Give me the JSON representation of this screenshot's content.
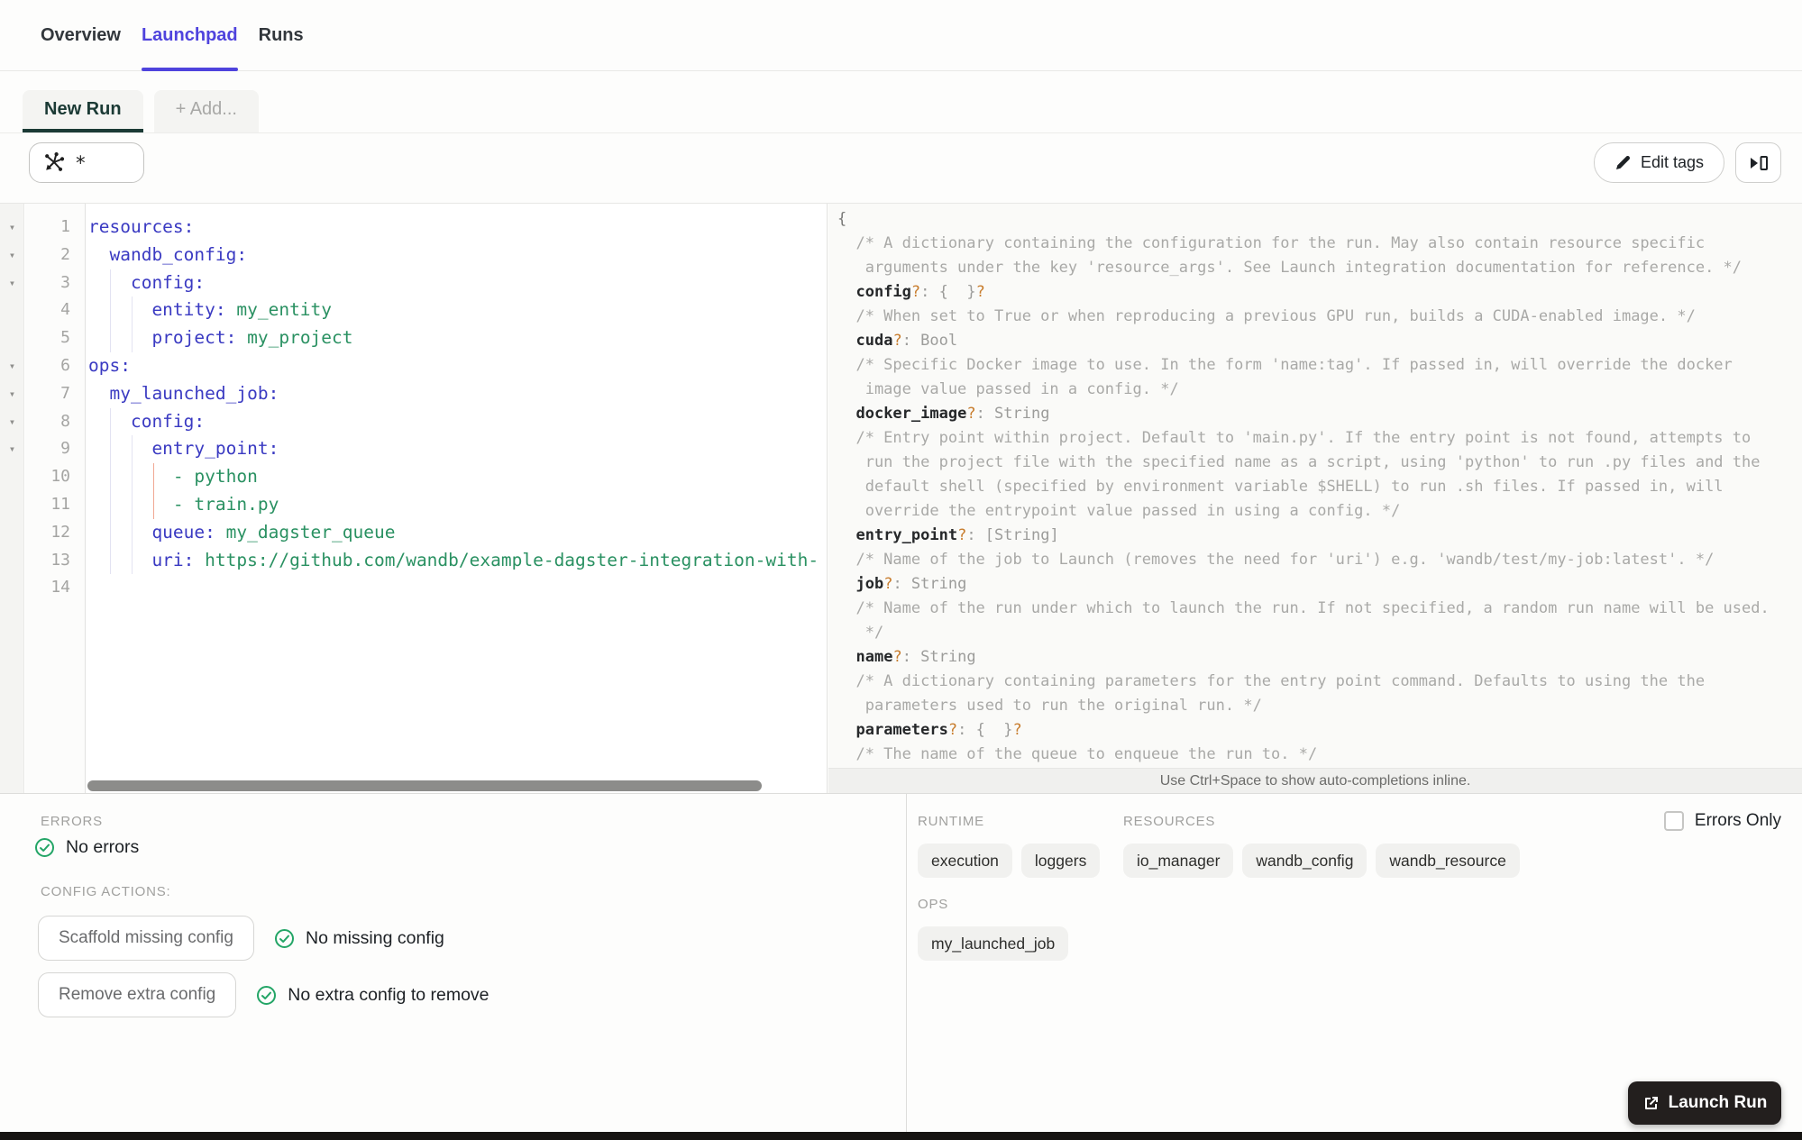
{
  "tabs": {
    "items": [
      {
        "label": "Overview",
        "active": false
      },
      {
        "label": "Launchpad",
        "active": true
      },
      {
        "label": "Runs",
        "active": false
      }
    ]
  },
  "subtabs": {
    "items": [
      {
        "label": "New Run",
        "active": true
      },
      {
        "label": "+ Add...",
        "active": false
      }
    ]
  },
  "toolbar": {
    "op_selector_value": "*",
    "op_selector_icon": "op-splat-icon",
    "edit_tags_label": "Edit tags",
    "edit_tags_icon": "pencil-icon",
    "expand_panel_icon": "play-into-pane-icon"
  },
  "editor": {
    "lines": [
      {
        "n": 1,
        "fold": true,
        "segs": [
          {
            "t": "resources:",
            "c": "key"
          }
        ]
      },
      {
        "n": 2,
        "fold": true,
        "segs": [
          {
            "t": "  wandb_config:",
            "c": "key"
          }
        ]
      },
      {
        "n": 3,
        "fold": true,
        "segs": [
          {
            "t": "    config:",
            "c": "key"
          }
        ]
      },
      {
        "n": 4,
        "fold": false,
        "segs": [
          {
            "t": "      entity:",
            "c": "key"
          },
          {
            "t": " my_entity",
            "c": "val"
          }
        ]
      },
      {
        "n": 5,
        "fold": false,
        "segs": [
          {
            "t": "      project:",
            "c": "key"
          },
          {
            "t": " my_project",
            "c": "val"
          }
        ]
      },
      {
        "n": 6,
        "fold": true,
        "segs": [
          {
            "t": "ops:",
            "c": "key"
          }
        ]
      },
      {
        "n": 7,
        "fold": true,
        "segs": [
          {
            "t": "  my_launched_job:",
            "c": "key"
          }
        ]
      },
      {
        "n": 8,
        "fold": true,
        "segs": [
          {
            "t": "    config:",
            "c": "key"
          }
        ]
      },
      {
        "n": 9,
        "fold": true,
        "segs": [
          {
            "t": "      entry_point:",
            "c": "key"
          }
        ]
      },
      {
        "n": 10,
        "fold": false,
        "segs": [
          {
            "t": "        - python",
            "c": "val"
          }
        ]
      },
      {
        "n": 11,
        "fold": false,
        "segs": [
          {
            "t": "        - train.py",
            "c": "val"
          }
        ]
      },
      {
        "n": 12,
        "fold": false,
        "segs": [
          {
            "t": "      queue:",
            "c": "key"
          },
          {
            "t": " my_dagster_queue",
            "c": "val"
          }
        ]
      },
      {
        "n": 13,
        "fold": false,
        "segs": [
          {
            "t": "      uri:",
            "c": "key"
          },
          {
            "t": " https://github.com/wandb/example-dagster-integration-with-",
            "c": "val"
          }
        ]
      },
      {
        "n": 14,
        "fold": false,
        "segs": []
      }
    ]
  },
  "doc_panel": {
    "hint": "Use Ctrl+Space to show auto-completions inline.",
    "lines": [
      {
        "segs": [
          {
            "t": "{",
            "c": "brace"
          }
        ]
      },
      {
        "segs": [
          {
            "t": "  /* A dictionary containing the configuration for the run. May also contain resource specific",
            "c": "comment"
          }
        ]
      },
      {
        "segs": [
          {
            "t": "   arguments under the key 'resource_args'. See Launch integration documentation for reference. */",
            "c": "comment"
          }
        ]
      },
      {
        "segs": [
          {
            "t": "  ",
            "c": "plain"
          },
          {
            "t": "config",
            "c": "key"
          },
          {
            "t": "?",
            "c": "q"
          },
          {
            "t": ": {  }",
            "c": "type"
          },
          {
            "t": "?",
            "c": "q"
          }
        ]
      },
      {
        "segs": [
          {
            "t": "  /* When set to True or when reproducing a previous GPU run, builds a CUDA-enabled image. */",
            "c": "comment"
          }
        ]
      },
      {
        "segs": [
          {
            "t": "  ",
            "c": "plain"
          },
          {
            "t": "cuda",
            "c": "key"
          },
          {
            "t": "?",
            "c": "q"
          },
          {
            "t": ": Bool",
            "c": "type"
          }
        ]
      },
      {
        "segs": [
          {
            "t": "  /* Specific Docker image to use. In the form 'name:tag'. If passed in, will override the docker",
            "c": "comment"
          }
        ]
      },
      {
        "segs": [
          {
            "t": "   image value passed in a config. */",
            "c": "comment"
          }
        ]
      },
      {
        "segs": [
          {
            "t": "  ",
            "c": "plain"
          },
          {
            "t": "docker_image",
            "c": "key"
          },
          {
            "t": "?",
            "c": "q"
          },
          {
            "t": ": String",
            "c": "type"
          }
        ]
      },
      {
        "segs": [
          {
            "t": "  /* Entry point within project. Default to 'main.py'. If the entry point is not found, attempts to",
            "c": "comment"
          }
        ]
      },
      {
        "segs": [
          {
            "t": "   run the project file with the specified name as a script, using 'python' to run .py files and the",
            "c": "comment"
          }
        ]
      },
      {
        "segs": [
          {
            "t": "   default shell (specified by environment variable $SHELL) to run .sh files. If passed in, will",
            "c": "comment"
          }
        ]
      },
      {
        "segs": [
          {
            "t": "   override the entrypoint value passed in using a config. */",
            "c": "comment"
          }
        ]
      },
      {
        "segs": [
          {
            "t": "  ",
            "c": "plain"
          },
          {
            "t": "entry_point",
            "c": "key"
          },
          {
            "t": "?",
            "c": "q"
          },
          {
            "t": ": [String]",
            "c": "type"
          }
        ]
      },
      {
        "segs": [
          {
            "t": "  /* Name of the job to Launch (removes the need for 'uri') e.g. 'wandb/test/my-job:latest'. */",
            "c": "comment"
          }
        ]
      },
      {
        "segs": [
          {
            "t": "  ",
            "c": "plain"
          },
          {
            "t": "job",
            "c": "key"
          },
          {
            "t": "?",
            "c": "q"
          },
          {
            "t": ": String",
            "c": "type"
          }
        ]
      },
      {
        "segs": [
          {
            "t": "  /* Name of the run under which to launch the run. If not specified, a random run name will be used.",
            "c": "comment"
          }
        ]
      },
      {
        "segs": [
          {
            "t": "   */",
            "c": "comment"
          }
        ]
      },
      {
        "segs": [
          {
            "t": "  ",
            "c": "plain"
          },
          {
            "t": "name",
            "c": "key"
          },
          {
            "t": "?",
            "c": "q"
          },
          {
            "t": ": String",
            "c": "type"
          }
        ]
      },
      {
        "segs": [
          {
            "t": "  /* A dictionary containing parameters for the entry point command. Defaults to using the the",
            "c": "comment"
          }
        ]
      },
      {
        "segs": [
          {
            "t": "   parameters used to run the original run. */",
            "c": "comment"
          }
        ]
      },
      {
        "segs": [
          {
            "t": "  ",
            "c": "plain"
          },
          {
            "t": "parameters",
            "c": "key"
          },
          {
            "t": "?",
            "c": "q"
          },
          {
            "t": ": {  }",
            "c": "type"
          },
          {
            "t": "?",
            "c": "q"
          }
        ]
      },
      {
        "segs": [
          {
            "t": "  /* The name of the queue to enqueue the run to. */",
            "c": "comment"
          }
        ]
      }
    ]
  },
  "errors_panel": {
    "errors_label": "ERRORS",
    "no_errors": "No errors",
    "config_actions_label": "CONFIG ACTIONS:",
    "actions": [
      {
        "button": "Scaffold missing config",
        "status": "No missing config"
      },
      {
        "button": "Remove extra config",
        "status": "No extra config to remove"
      }
    ]
  },
  "target_panel": {
    "runtime_label": "RUNTIME",
    "runtime_tags": [
      "execution",
      "loggers"
    ],
    "resources_label": "RESOURCES",
    "resource_tags": [
      "io_manager",
      "wandb_config",
      "wandb_resource"
    ],
    "ops_label": "OPS",
    "ops_tags": [
      "my_launched_job"
    ],
    "errors_only_label": "Errors Only",
    "errors_only_checked": false
  },
  "launch": {
    "label": "Launch Run",
    "icon": "external-link-icon"
  },
  "colors": {
    "accent_purple": "#4f43dd",
    "active_subtab_green": "#1b3a35",
    "yaml_key_blue": "#3a3ac2",
    "yaml_value_green": "#2a9162",
    "success_green": "#23a566",
    "optional_marker_orange": "#c87d2e",
    "active_indent_guide_orange": "#f1a893",
    "launch_button_bg": "#231f1e"
  }
}
